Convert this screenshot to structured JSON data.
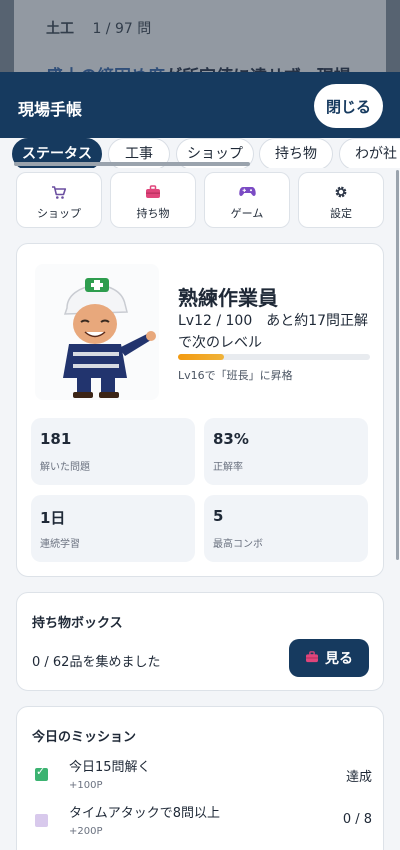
{
  "background": {
    "category": "土工",
    "progress": "1 / 97 問",
    "question_parts": [
      "盛土の",
      "締固め度",
      "が所定値に達せず、現場"
    ]
  },
  "header": {
    "title": "現場手帳",
    "close_label": "閉じる"
  },
  "tabs": [
    {
      "label": "ステータス",
      "active": true
    },
    {
      "label": "工事",
      "active": false
    },
    {
      "label": "ショップ",
      "active": false
    },
    {
      "label": "持ち物",
      "active": false
    },
    {
      "label": "わが社",
      "active": false
    }
  ],
  "quick_actions": [
    {
      "label": "ショップ",
      "icon": "cart-icon"
    },
    {
      "label": "持ち物",
      "icon": "toolbox-icon"
    },
    {
      "label": "ゲーム",
      "icon": "gamepad-icon"
    },
    {
      "label": "設定",
      "icon": "gear-icon"
    }
  ],
  "status": {
    "rank": "熟練作業員",
    "level_line": "Lv12 / 100　あと約17問正解で次のレベル",
    "xp_progress": 0.24,
    "promotion": "Lv16で「班長」に昇格",
    "stats": [
      {
        "value": "181",
        "label": "解いた問題"
      },
      {
        "value": "83%",
        "label": "正解率"
      },
      {
        "value": "1日",
        "label": "連続学習"
      },
      {
        "value": "5",
        "label": "最高コンボ"
      }
    ]
  },
  "inventory": {
    "title": "持ち物ボックス",
    "count_text": "0 / 62品を集めました",
    "view_label": "見る"
  },
  "missions": {
    "title": "今日のミッション",
    "items": [
      {
        "text": "今日15問解く",
        "points": "+100P",
        "status": "達成",
        "done": true
      },
      {
        "text": "タイムアタックで8問以上",
        "points": "+200P",
        "status": "0 / 8",
        "done": false
      }
    ]
  },
  "colors": {
    "primary": "#163a5f",
    "accent": "#f39a10",
    "done": "#3cb371"
  }
}
